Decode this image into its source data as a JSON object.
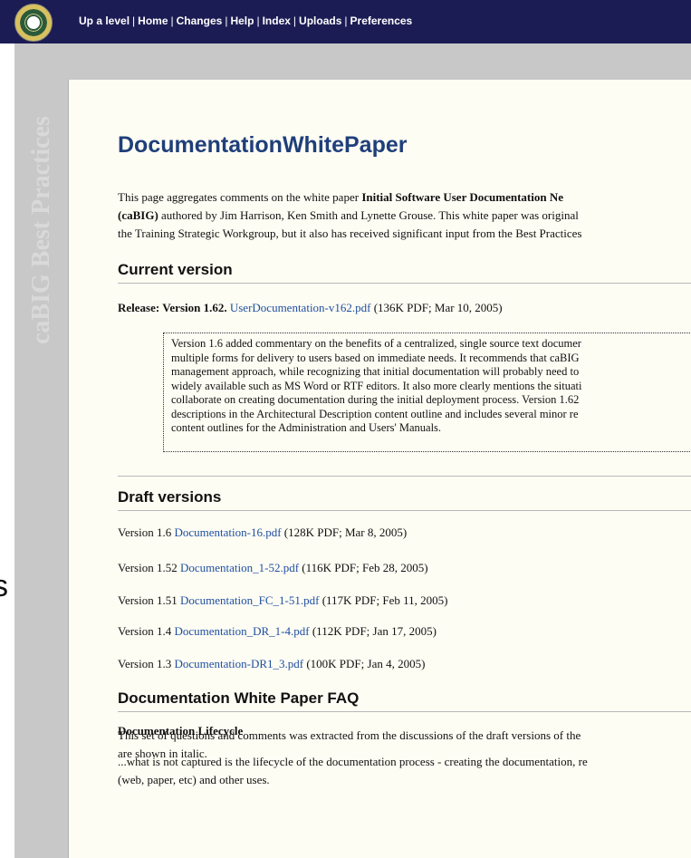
{
  "nav": {
    "up": "Up a level",
    "home": "Home",
    "changes": "Changes",
    "help": "Help",
    "index": "Index",
    "uploads": "Uploads",
    "preferences": "Preferences",
    "separator": "|"
  },
  "sidebar": {
    "title": "caBIG Best Practices"
  },
  "stray": {
    "text": "s"
  },
  "page": {
    "title": "DocumentationWhitePaper",
    "intro": {
      "l1_a": "This page aggregates comments on the white paper ",
      "l1_b": "Initial Software User Documentation Ne",
      "l2_a": "(caBIG)",
      "l2_b": " authored by Jim Harrison, Ken Smith and Lynette Grouse. This white paper was original",
      "l3": "the Training Strategic Workgroup, but it also has received significant input from the Best Practices"
    },
    "current": {
      "heading": "Current version",
      "release_label": "Release: Version 1.62.",
      "release_link": "UserDocumentation-v162.pdf",
      "release_meta": " (136K PDF; Mar 10, 2005)",
      "quote": [
        "Version 1.6 added commentary on the benefits of a centralized, single source text documer",
        "multiple forms for delivery to users based on immediate needs. It recommends that caBIG",
        "management approach, while recognizing that initial documentation will probably need to",
        "widely available such as MS Word or RTF editors. It also more clearly mentions the situati",
        "collaborate on creating documentation during the initial deployment process. Version 1.62",
        "descriptions in the Architectural Description content outline and includes several minor re",
        "content outlines for the Administration and Users' Manuals."
      ]
    },
    "drafts": {
      "heading": "Draft versions",
      "items": [
        {
          "label": "Version 1.6 ",
          "link": "Documentation-16.pdf",
          "meta": " (128K PDF; Mar 8, 2005)"
        },
        {
          "label": "Version 1.52 ",
          "link": "Documentation_1-52.pdf",
          "meta": " (116K PDF; Feb 28, 2005)"
        },
        {
          "label": "Version 1.51 ",
          "link": "Documentation_FC_1-51.pdf",
          "meta": " (117K PDF; Feb 11, 2005)"
        },
        {
          "label": "Version 1.4 ",
          "link": "Documentation_DR_1-4.pdf",
          "meta": " (112K PDF; Jan 17, 2005)"
        },
        {
          "label": "Version 1.3 ",
          "link": "Documentation-DR1_3.pdf",
          "meta": " (100K PDF; Jan 4, 2005)"
        }
      ]
    },
    "faq": {
      "heading": "Documentation White Paper FAQ",
      "p1": "This set of questions and comments was extracted from the discussions of the draft versions of the",
      "p2": "are shown in italic.",
      "subheading": "Documentation Lifecycle",
      "p3": "...what is not captured is the lifecycle of the documentation process - creating the documentation, re",
      "p4": "(web, paper, etc) and other uses."
    }
  }
}
